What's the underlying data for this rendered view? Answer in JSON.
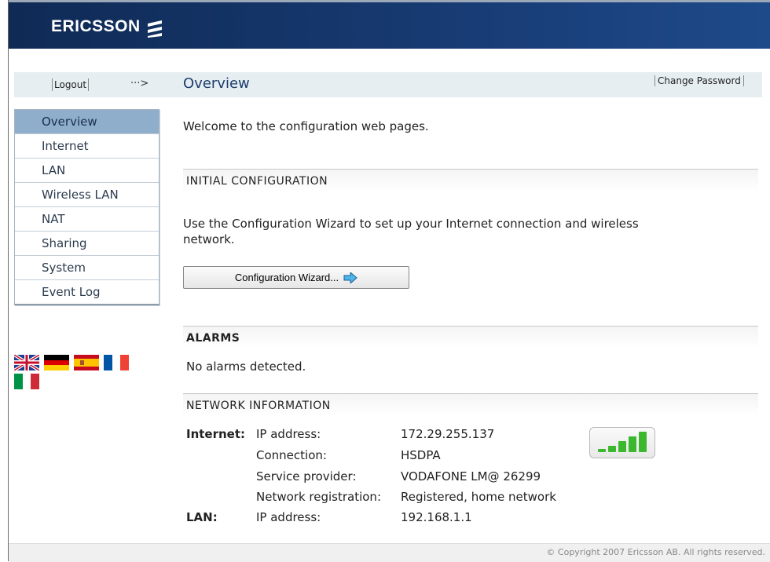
{
  "header": {
    "brand": "ERICSSON"
  },
  "toolbar": {
    "logout_label": "Logout",
    "arrow": "···>",
    "page_title": "Overview",
    "change_password_label": "Change Password"
  },
  "nav": {
    "items": [
      {
        "label": "Overview",
        "active": true
      },
      {
        "label": "Internet"
      },
      {
        "label": "LAN"
      },
      {
        "label": "Wireless LAN"
      },
      {
        "label": "NAT"
      },
      {
        "label": "Sharing"
      },
      {
        "label": "System"
      },
      {
        "label": "Event Log"
      }
    ]
  },
  "languages": [
    "english-flag",
    "german-flag",
    "spanish-flag",
    "french-flag",
    "italian-flag"
  ],
  "main": {
    "welcome": "Welcome to the configuration web pages.",
    "initial_config": {
      "heading": "INITIAL CONFIGURATION",
      "text_line1": "Use the Configuration Wizard to set up your Internet connection and wireless",
      "text_line2": "network.",
      "button_label": "Configuration Wizard..."
    },
    "alarms": {
      "heading": "ALARMS",
      "text": "No alarms detected."
    },
    "network": {
      "heading": "NETWORK INFORMATION",
      "internet_label": "Internet:",
      "lan_label": "LAN:",
      "rows": [
        {
          "key": "IP address:",
          "value": "172.29.255.137"
        },
        {
          "key": "Connection:",
          "value": "HSDPA"
        },
        {
          "key": "Service provider:",
          "value": "VODAFONE LM@ 26299"
        },
        {
          "key": "Network registration:",
          "value": "Registered, home network"
        }
      ],
      "lan_row": {
        "key": "IP address:",
        "value": "192.168.1.1"
      },
      "signal_level": 5
    }
  },
  "footer": {
    "copyright": "© Copyright 2007 Ericsson AB. All rights reserved."
  },
  "colors": {
    "header_bg": "#173a72",
    "nav_active": "#8eaecb",
    "title": "#1d3d6b",
    "signal_green": "#3cb82e"
  }
}
